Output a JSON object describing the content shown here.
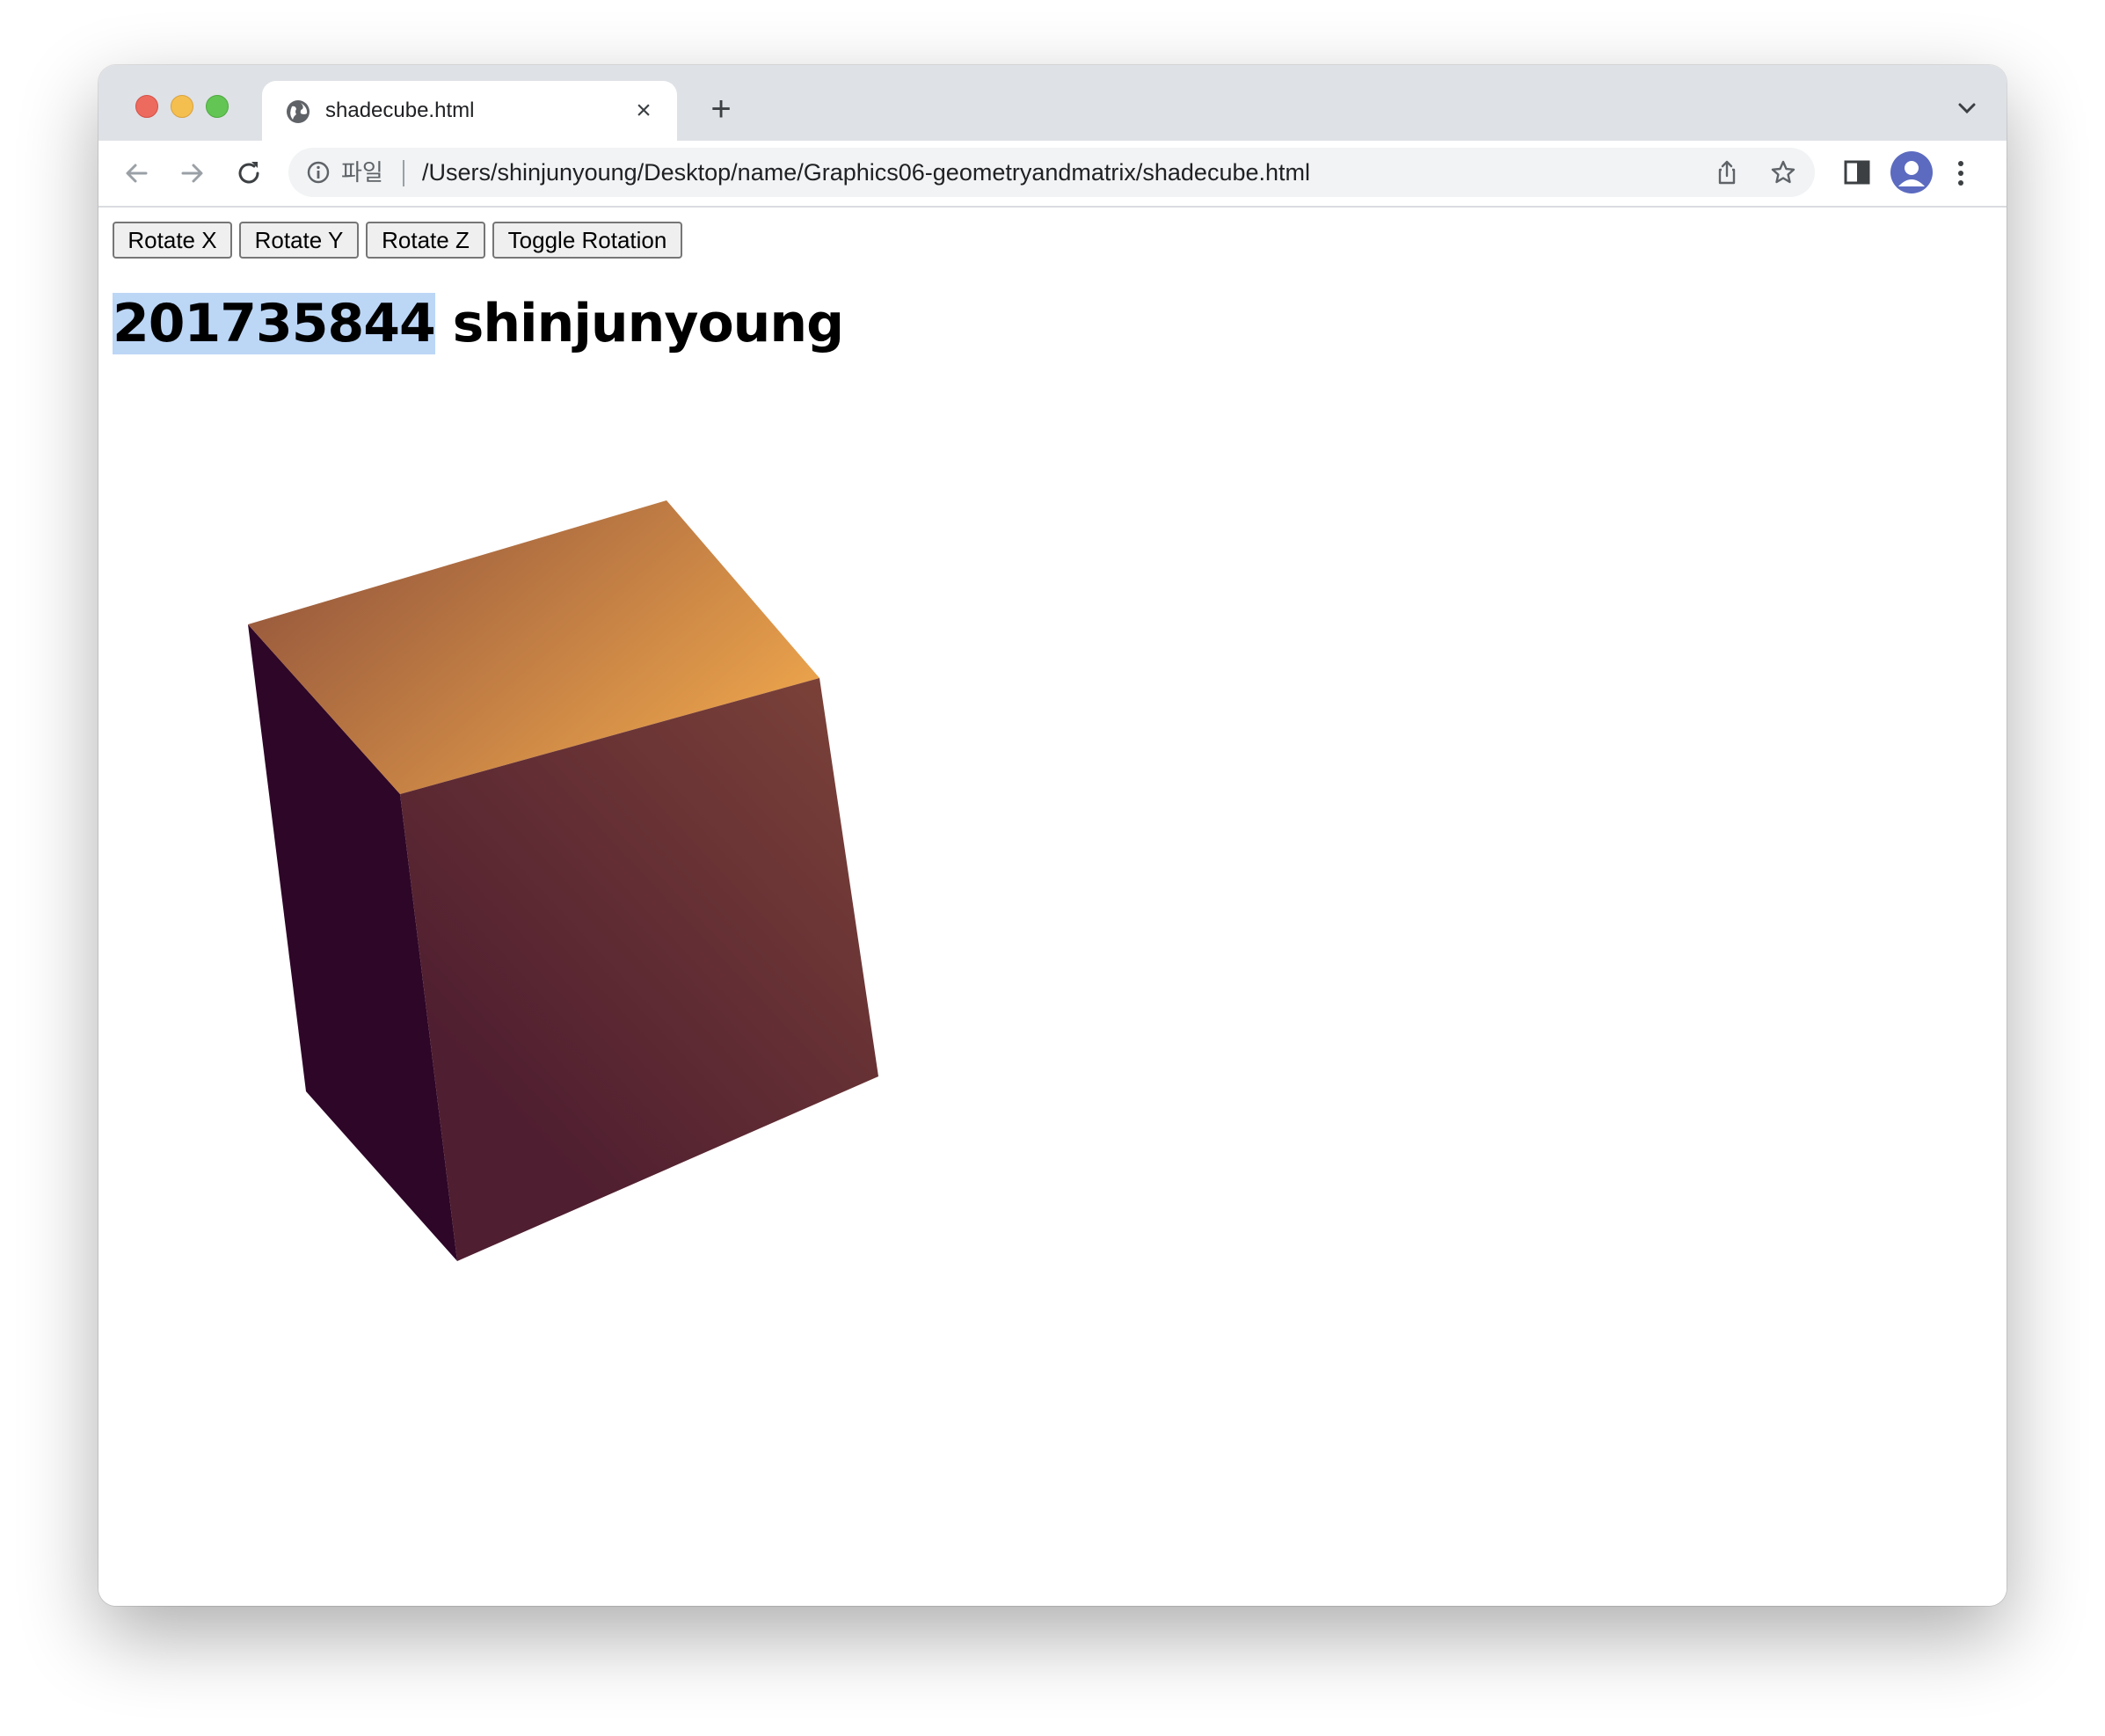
{
  "browser": {
    "tab": {
      "title": "shadecube.html"
    },
    "address_bar": {
      "scheme_label": "파일",
      "url": "/Users/shinjunyoung/Desktop/name/Graphics06-geometryandmatrix/shadecube.html"
    }
  },
  "page": {
    "buttons": {
      "rotate_x": "Rotate X",
      "rotate_y": "Rotate Y",
      "rotate_z": "Rotate Z",
      "toggle_rotation": "Toggle Rotation"
    },
    "heading": {
      "student_id": "201735844",
      "name": "shinjunyoung"
    },
    "cube": {
      "colors": {
        "top_dark": "#8a4d3a",
        "top_light": "#e9a14b",
        "front_light": "#7e4439",
        "front_dark": "#4f1e30",
        "side": "#2e0628"
      }
    }
  }
}
